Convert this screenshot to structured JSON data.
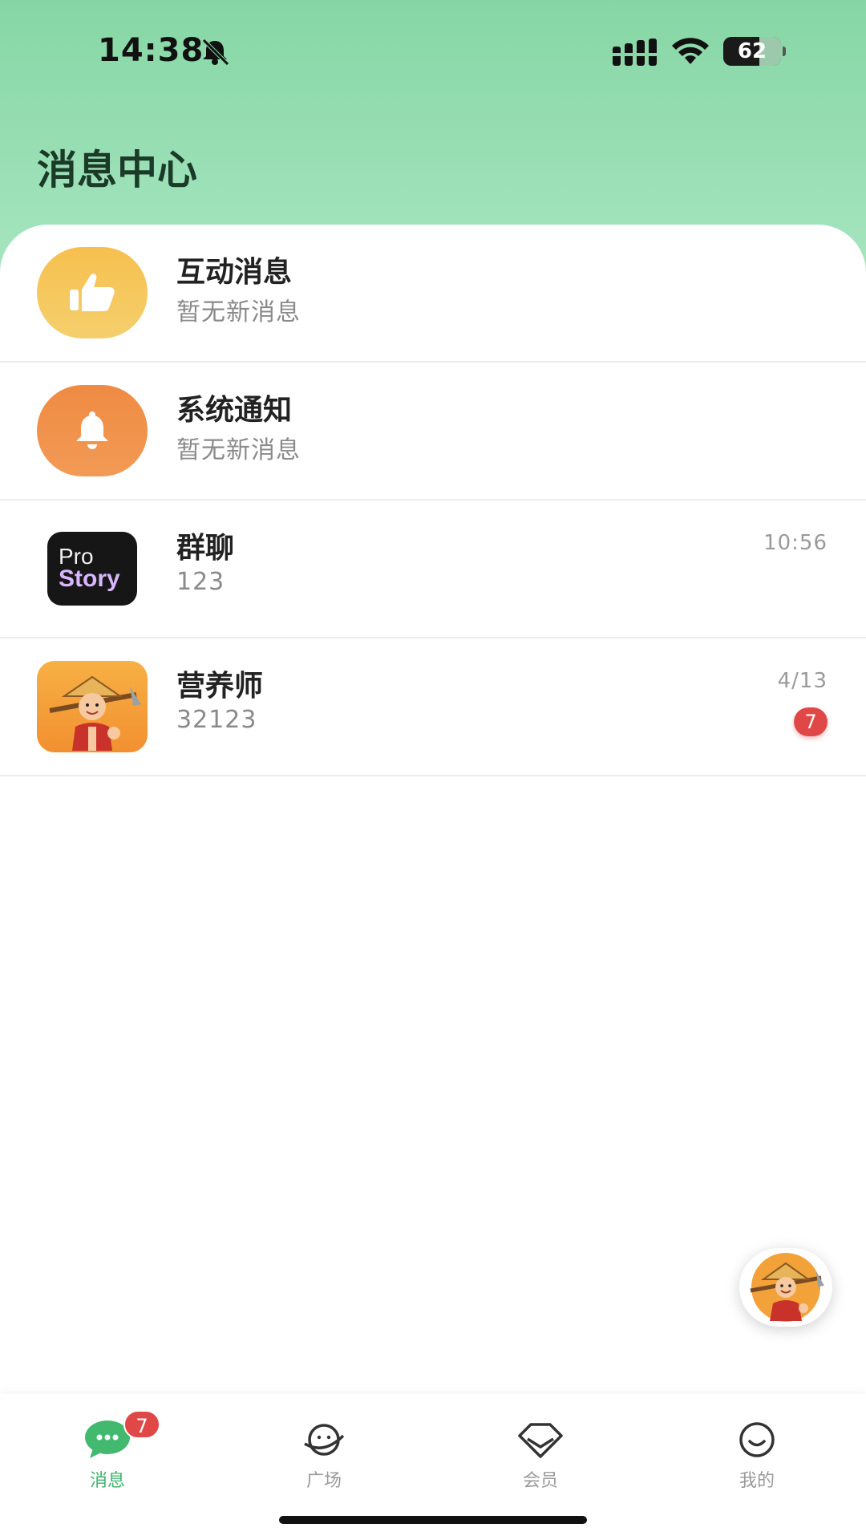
{
  "status_bar": {
    "time": "14:38",
    "battery_percent": "62",
    "battery_level": 0.62
  },
  "page": {
    "title": "消息中心"
  },
  "messages": [
    {
      "title": "互动消息",
      "subtitle": "暂无新消息",
      "icon": "thumbs-up-icon",
      "icon_bg": "#f5c04f"
    },
    {
      "title": "系统通知",
      "subtitle": "暂无新消息",
      "icon": "bell-icon",
      "icon_bg": "#f08c44"
    },
    {
      "title": "群聊",
      "subtitle": "123",
      "time": "10:56",
      "avatar_line1": "Pro",
      "avatar_line2": "Story"
    },
    {
      "title": "营养师",
      "subtitle": "32123",
      "time": "4/13",
      "badge": "7"
    }
  ],
  "tabbar": {
    "items": [
      {
        "label": "消息",
        "icon": "chat-bubble-icon",
        "badge": "7",
        "active": true
      },
      {
        "label": "广场",
        "icon": "planet-icon"
      },
      {
        "label": "会员",
        "icon": "diamond-icon"
      },
      {
        "label": "我的",
        "icon": "smile-icon"
      }
    ]
  },
  "colors": {
    "accent": "#3db46d",
    "header_bg": "#86d6a5",
    "badge": "#e04848"
  }
}
